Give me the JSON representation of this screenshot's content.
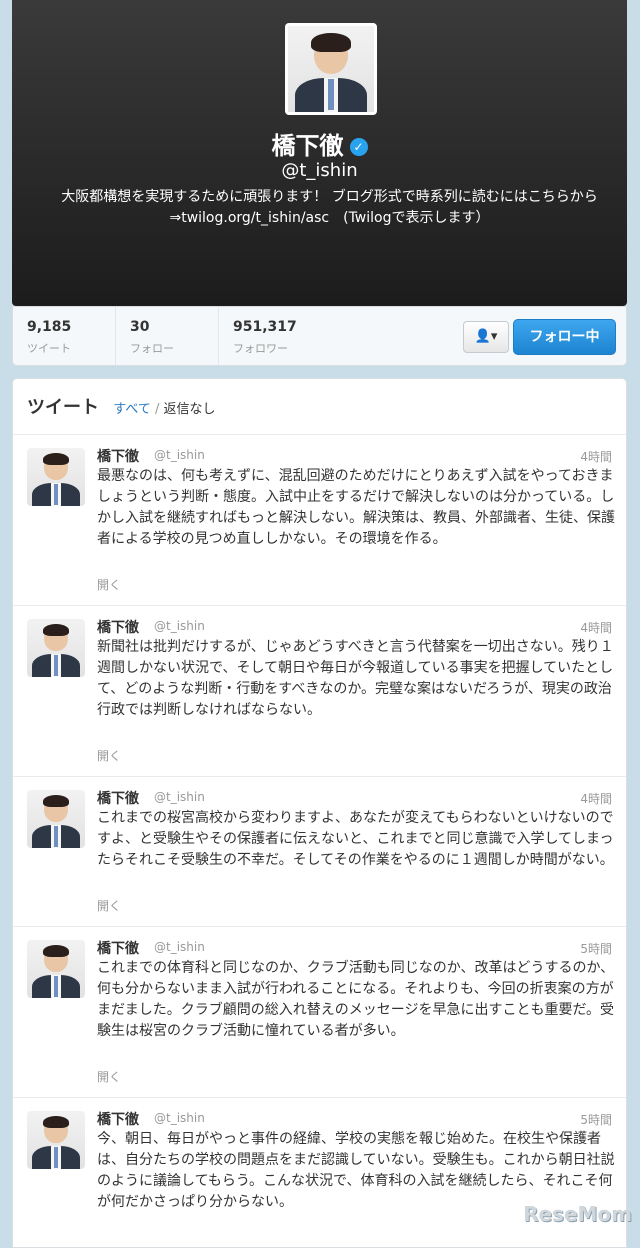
{
  "profile": {
    "name": "橋下徹",
    "verified_glyph": "✓",
    "handle": "@t_ishin",
    "bio": "大阪都構想を実現するために頑張ります！ ブログ形式で時系列に読むにはこちらから⇒twilog.org/t_ishin/asc　(Twilogで表示します）"
  },
  "stats": [
    {
      "count": "9,185",
      "label": "ツイート"
    },
    {
      "count": "30",
      "label": "フォロー"
    },
    {
      "count": "951,317",
      "label": "フォロワー"
    }
  ],
  "actions": {
    "user_menu_label": "👤▾",
    "follow_label": "フォロー中"
  },
  "timeline": {
    "title": "ツイート",
    "filter_all": "すべて",
    "filter_sep": "/",
    "filter_noreply": "返信なし"
  },
  "tweets": [
    {
      "name": "橋下徹",
      "handle": "@t_ishin",
      "time": "4時間",
      "text": "最悪なのは、何も考えずに、混乱回避のためだけにとりあえず入試をやっておきましょうという判断・態度。入試中止をするだけで解決しないのは分かっている。しかし入試を継続すればもっと解決しない。解決策は、教員、外部識者、生徒、保護者による学校の見つめ直ししかない。その環境を作る。",
      "expand": "開く"
    },
    {
      "name": "橋下徹",
      "handle": "@t_ishin",
      "time": "4時間",
      "text": "新聞社は批判だけするが、じゃあどうすべきと言う代替案を一切出さない。残り１週間しかない状況で、そして朝日や毎日が今報道している事実を把握していたとして、どのような判断・行動をすべきなのか。完璧な案はないだろうが、現実の政治行政では判断しなければならない。",
      "expand": "開く"
    },
    {
      "name": "橋下徹",
      "handle": "@t_ishin",
      "time": "4時間",
      "text": "これまでの桜宮高校から変わりますよ、あなたが変えてもらわないといけないのですよ、と受験生やその保護者に伝えないと、これまでと同じ意識で入学してしまったらそれこそ受験生の不幸だ。そしてその作業をやるのに１週間しか時間がない。",
      "expand": "開く"
    },
    {
      "name": "橋下徹",
      "handle": "@t_ishin",
      "time": "5時間",
      "text": "これまでの体育科と同じなのか、クラブ活動も同じなのか、改革はどうするのか、何も分からないまま入試が行われることになる。それよりも、今回の折衷案の方がまだました。クラブ顧問の総入れ替えのメッセージを早急に出すことも重要だ。受験生は桜宮のクラブ活動に憧れている者が多い。",
      "expand": "開く"
    },
    {
      "name": "橋下徹",
      "handle": "@t_ishin",
      "time": "5時間",
      "text": "今、朝日、毎日がやっと事件の経緯、学校の実態を報じ始めた。在校生や保護者は、自分たちの学校の問題点をまだ認識していない。受験生も。これから朝日社説のように議論してもらう。こんな状況で、体育科の入試を継続したら、それこそ何が何だかさっぱり分からない。",
      "expand": ""
    }
  ],
  "watermark": "ReseMom"
}
